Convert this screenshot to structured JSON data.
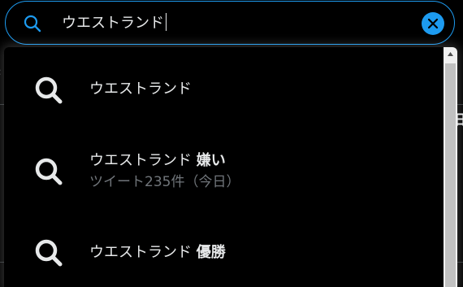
{
  "search": {
    "query": "ウエストランド",
    "icon": "search-icon",
    "clear_icon": "close-icon",
    "accent": "#1d9bf0"
  },
  "suggestions": [
    {
      "text": "ウエストランド",
      "bold_suffix": "",
      "subtitle": ""
    },
    {
      "text": "ウエストランド",
      "bold_suffix": "嫌い",
      "subtitle": "ツイート235件（今日）"
    },
    {
      "text": "ウエストランド",
      "bold_suffix": "優勝",
      "subtitle": ""
    }
  ],
  "background": {
    "partial_text": "旧"
  }
}
